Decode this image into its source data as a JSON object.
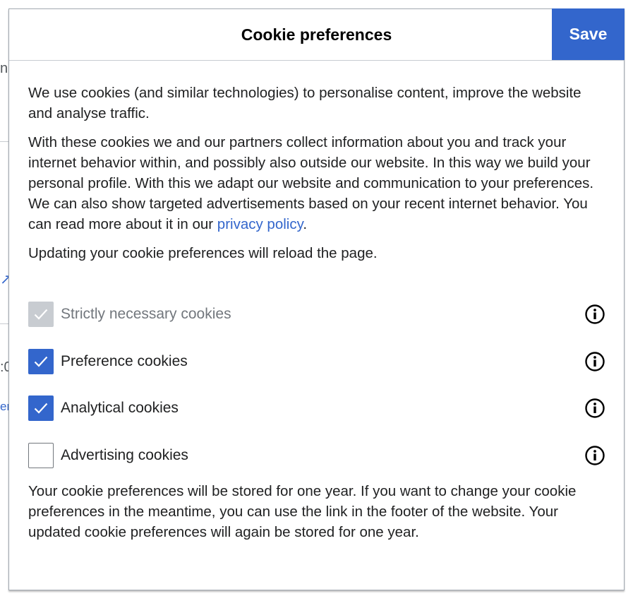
{
  "background": {
    "fragments": [
      "n",
      ":0",
      "er"
    ]
  },
  "dialog": {
    "title": "Cookie preferences",
    "save_label": "Save",
    "intro": "We use cookies (and similar technologies) to personalise content, improve the website and analyse traffic.",
    "collect_text": "With these cookies we and our partners collect information about you and track your internet behavior within, and possibly also outside our website. In this way we build your personal profile. With this we adapt our website and communication to your preferences. We can also show targeted advertisements based on your recent internet behavior. You can read more about it in our ",
    "privacy_link": "privacy policy",
    "collect_suffix": ".",
    "reload_notice": "Updating your cookie preferences will reload the page.",
    "options": [
      {
        "label": "Strictly necessary cookies",
        "checked": true,
        "disabled": true
      },
      {
        "label": "Preference cookies",
        "checked": true,
        "disabled": false
      },
      {
        "label": "Analytical cookies",
        "checked": true,
        "disabled": false
      },
      {
        "label": "Advertising cookies",
        "checked": false,
        "disabled": false
      }
    ],
    "footer": "Your cookie preferences will be stored for one year. If you want to change your cookie preferences in the meantime, you can use the link in the footer of the website. Your updated cookie preferences will again be stored for one year."
  },
  "colors": {
    "accent": "#3366cc",
    "disabled": "#c8ccd1",
    "text": "#202122",
    "muted": "#72777d"
  }
}
